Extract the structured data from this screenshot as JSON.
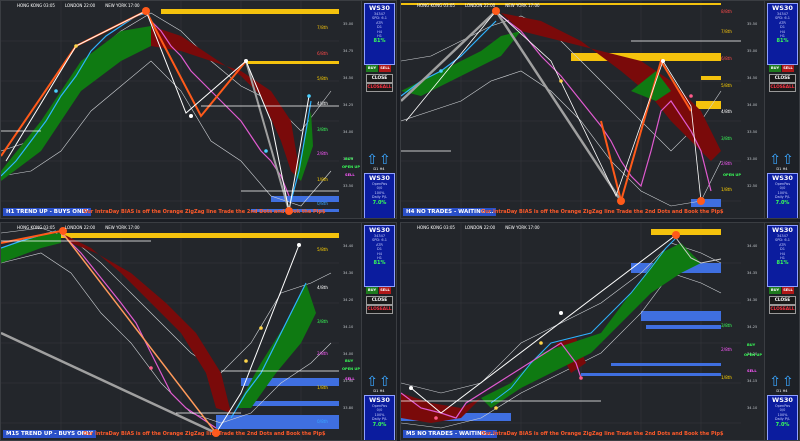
{
  "sessions": [
    "HONG KONG 03:05",
    "LONDON 22:00",
    "NEW YORK 17:00"
  ],
  "bias_text": "Our IntraDay BIAS is off the Orange ZigZag line   Trade the 2nd Dots and Book the Pip$",
  "colors": {
    "up_fill": "#0f7a12",
    "down_fill": "#7a0a0a",
    "zigzag_orange": "#ff5a1a",
    "zigzag_gray": "#9a9a9a",
    "blue_zone": "#3f6fe0",
    "yellow_zone": "#f4c20d"
  },
  "panels": [
    {
      "id": "top-left",
      "status": "H1 TREND UP - BUYS ONLY",
      "symbol": {
        "name": "WS30",
        "lines": [
          "34347",
          "SPD: 6.1",
          "ATR",
          "D1",
          "H4",
          "H1"
        ],
        "pct": "81%"
      },
      "buttons": {
        "buy": "BUY",
        "sell": "SELL",
        "close": "CLOSE",
        "close_all": "CLOSEALL"
      },
      "tf_labels": [
        "D1",
        "H4"
      ],
      "mini_panel": {
        "name": "WS30",
        "lines": [
          "OpenPos",
          "0/0",
          "100%",
          "Daily P/L"
        ],
        "pct": "7.0%"
      },
      "fib_labels": [
        "7/8th",
        "6/8th",
        "5/8th",
        "4/8th",
        "3/8th",
        "2/8th",
        "1/8th",
        "0/8th"
      ],
      "open_up": "OPEN UP",
      "prices": [
        "35.00",
        "34.75",
        "34.50",
        "34.25",
        "34.00",
        "33.75",
        "33.50",
        "33.25"
      ]
    },
    {
      "id": "top-right",
      "status": "H4 NO TRADES - WAITING ...",
      "symbol": {
        "name": "WS30",
        "lines": [
          "34347",
          "SPD: 6.1",
          "ATR",
          "D1",
          "H4",
          "H1"
        ],
        "pct": "81%"
      },
      "buttons": {
        "buy": "BUY",
        "sell": "SELL",
        "close": "CLOSE",
        "close_all": "CLOSEALL"
      },
      "tf_labels": [
        "D1",
        "H4"
      ],
      "mini_panel": {
        "name": "WS30",
        "lines": [
          "OpenPos",
          "0/0",
          "100%",
          "Daily P/L"
        ],
        "pct": "7.0%"
      },
      "fib_labels": [
        "8/8th",
        "7/8th",
        "6/8th",
        "5/8th",
        "4/8th",
        "3/8th",
        "2/8th",
        "1/8th"
      ],
      "open_up": "OPEN UP",
      "prices": [
        "35.50",
        "35.00",
        "34.50",
        "34.00",
        "33.50",
        "33.00",
        "32.50",
        "32.00"
      ]
    },
    {
      "id": "bottom-left",
      "status": "M15 TREND UP - BUYS ONLY",
      "symbol": {
        "name": "WS30",
        "lines": [
          "34347",
          "SPD: 6.1",
          "ATR",
          "D1",
          "H4",
          "H1"
        ],
        "pct": "81%"
      },
      "buttons": {
        "buy": "BUY",
        "sell": "SELL",
        "close": "CLOSE",
        "close_all": "CLOSEALL"
      },
      "tf_labels": [
        "D1",
        "H4"
      ],
      "mini_panel": {
        "name": "WS30",
        "lines": [
          "OpenPos",
          "0/0",
          "100%",
          "Daily P/L"
        ],
        "pct": "7.0%"
      },
      "fib_labels": [
        "5/8th",
        "4/8th",
        "3/8th",
        "2/8th",
        "1/8th",
        "0/8th"
      ],
      "open_up": "OPEN UP",
      "prices": [
        "34.40",
        "34.30",
        "34.20",
        "34.10",
        "34.00",
        "33.90",
        "33.80",
        "33.70"
      ]
    },
    {
      "id": "bottom-right",
      "status": "M5 NO TRADES - WAITING ...",
      "symbol": {
        "name": "WS30",
        "lines": [
          "34347",
          "SPD: 6.1",
          "ATR",
          "D1",
          "H4",
          "H1"
        ],
        "pct": "81%"
      },
      "buttons": {
        "buy": "BUY",
        "sell": "SELL",
        "close": "CLOSE",
        "close_all": "CLOSEALL"
      },
      "tf_labels": [
        "D1",
        "H4"
      ],
      "mini_panel": {
        "name": "WS30",
        "lines": [
          "OpenPos",
          "0/0",
          "100%",
          "Daily P/L"
        ],
        "pct": "7.0%"
      },
      "fib_labels": [
        "3/8th",
        "2/8th",
        "1/8th"
      ],
      "open_up": "OPEN UP",
      "prices": [
        "34.40",
        "34.35",
        "34.30",
        "34.25",
        "34.20",
        "34.15",
        "34.10",
        "34.05"
      ]
    }
  ]
}
